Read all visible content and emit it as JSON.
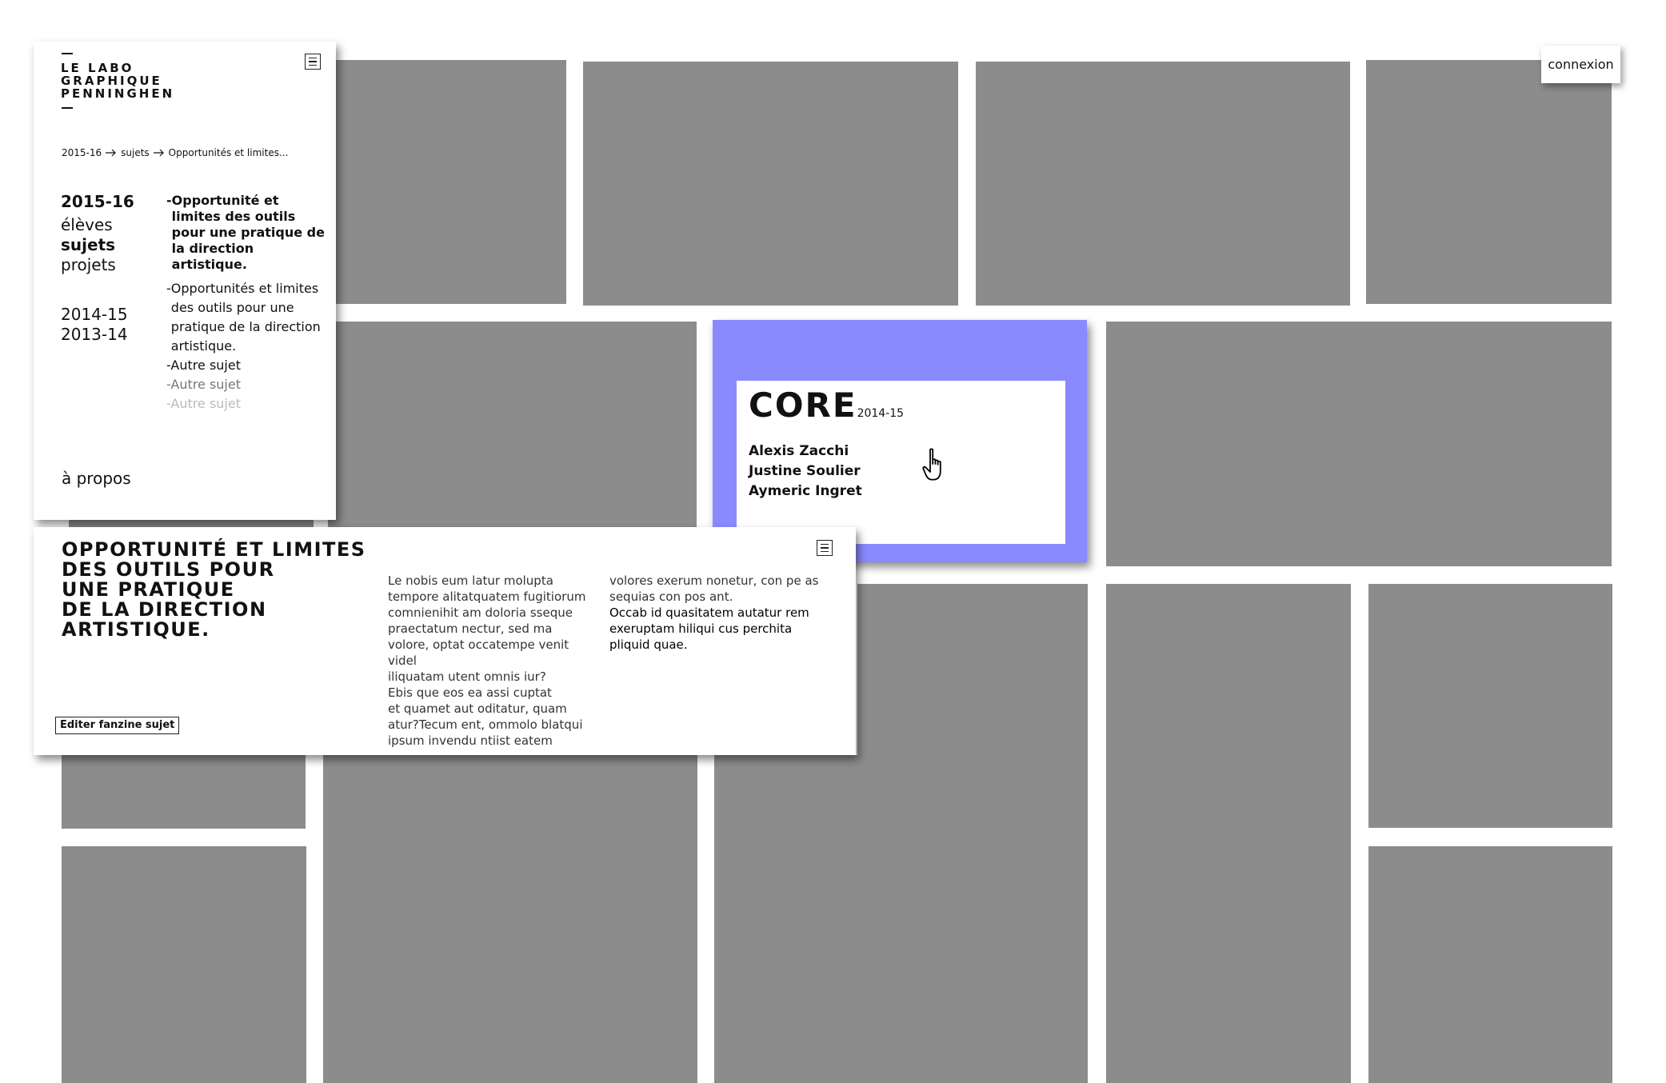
{
  "site": {
    "logo_lines": [
      "LE LABO",
      "GRAPHIQUE",
      "PENNINGHEN"
    ]
  },
  "breadcrumb": {
    "items": [
      "2015-16",
      "sujets",
      "Opportunités et limites..."
    ],
    "separator_icon": "arrow-right-icon"
  },
  "nav": {
    "current_year": "2015-16",
    "sections": [
      "élèves",
      "sujets",
      "projets"
    ],
    "active_section": "sujets",
    "other_years": [
      "2014-15",
      "2013-14"
    ],
    "subjects": [
      {
        "label": "Opportunité et limites des outils pour une pratique de la direction artistique.",
        "state": "active"
      },
      {
        "label": "Opportunités et limites des outils pour une pratique de la direction artistique.",
        "state": "normal"
      },
      {
        "label": "Autre sujet",
        "state": "normal"
      },
      {
        "label": "Autre sujet",
        "state": "faded"
      },
      {
        "label": "Autre sujet",
        "state": "faded-more"
      }
    ],
    "about": "à propos"
  },
  "header": {
    "login": "connexion"
  },
  "project_card": {
    "title": "CORE",
    "year": "2014-15",
    "students": [
      "Alexis Zacchi",
      "Justine Soulier",
      "Aymeric Ingret"
    ],
    "accent_color": "#8a8aff"
  },
  "subject_panel": {
    "title_lines": [
      "OPPORTUNITÉ ET LIMITES",
      "DES OUTILS POUR",
      "UNE PRATIQUE",
      "DE LA DIRECTION",
      "ARTISTIQUE."
    ],
    "col1_lines": [
      "Le nobis eum latur molupta",
      "tempore alitatquatem fugitiorum",
      "comnienihit am doloria sseque",
      "praectatum nectur, sed ma",
      "volore, optat occatempe venit videl",
      "iliquatam utent omnis iur?",
      "Ebis que eos ea assi cuptat",
      "et quamet aut oditatur, quam",
      "atur?Tecum ent, ommolo blatqui",
      "ipsum invendu ntiist eatem"
    ],
    "col2_lines": [
      "volores exerum nonetur, con pe as",
      "sequias con pos ant."
    ],
    "col2_dark_lines": [
      "Occab id quasitatem autatur rem",
      "exeruptam hiliqui cus perchita",
      "pliquid quae."
    ],
    "edit_button": "Editer fanzine sujet"
  },
  "colors": {
    "tile": "#8c8c8c",
    "background": "#ffffff",
    "accent": "#8a8aff"
  }
}
